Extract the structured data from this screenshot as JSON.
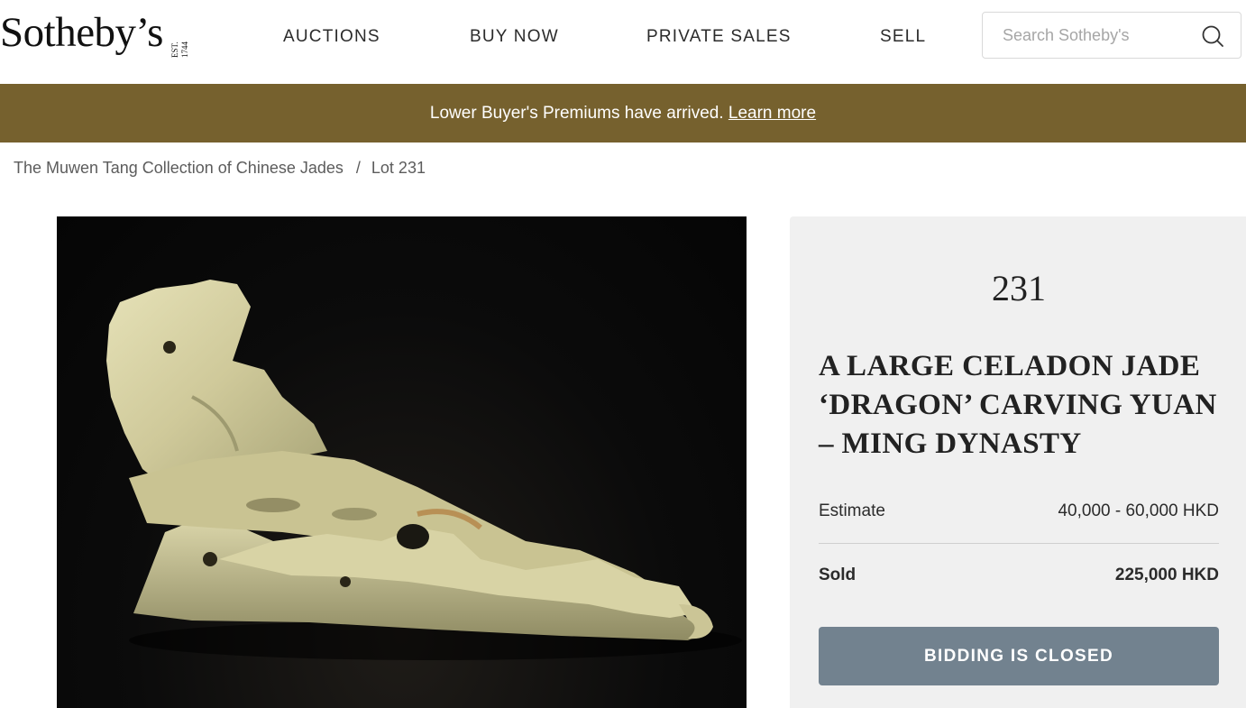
{
  "header": {
    "logo_text": "Sotheby’s",
    "logo_est": "EST. 1744",
    "nav": [
      "AUCTIONS",
      "BUY NOW",
      "PRIVATE SALES",
      "SELL"
    ],
    "search_placeholder": "Search Sotheby's",
    "search_icon": "search-icon"
  },
  "banner": {
    "text": "Lower Buyer's Premiums have arrived.",
    "link": "Learn more"
  },
  "breadcrumb": {
    "collection": "The Muwen Tang Collection of Chinese Jades",
    "separator": "/",
    "lot": "Lot 231"
  },
  "lot": {
    "number": "231",
    "title": "A LARGE CELADON JADE ‘DRAGON’ CARVING YUAN – MING DYNASTY",
    "estimate_label": "Estimate",
    "estimate_value": "40,000 - 60,000 HKD",
    "sold_label": "Sold",
    "sold_value": "225,000 HKD",
    "status_button": "BIDDING IS CLOSED"
  },
  "colors": {
    "banner_bg": "#76612e",
    "button_bg": "#72828f",
    "panel_bg": "#f0f0f0"
  }
}
